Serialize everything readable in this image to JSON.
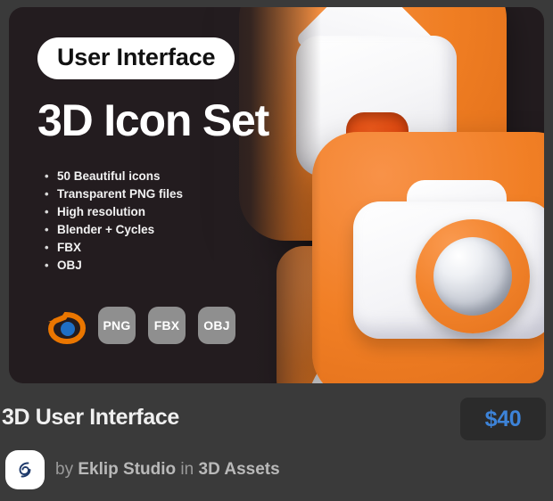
{
  "colors": {
    "page_background": "#3a3a3a",
    "card_background": "#231c1f",
    "accent_orange": "#f07e23",
    "price_blue": "#3d83d8",
    "badge_gray": "#8f8f8f",
    "blender_blue": "#1f6fc4",
    "blender_orange": "#ea7600",
    "avatar_logo": "#1f3a6b"
  },
  "preview": {
    "pill_label": "User Interface",
    "headline": "3D Icon Set",
    "features": [
      "50 Beautiful icons",
      "Transparent PNG files",
      "High resolution",
      "Blender + Cycles",
      "FBX",
      "OBJ"
    ],
    "formats": [
      {
        "icon": "blender-logo",
        "label": ""
      },
      {
        "icon": "file-format-badge",
        "label": "PNG"
      },
      {
        "icon": "file-format-badge",
        "label": "FBX"
      },
      {
        "icon": "file-format-badge",
        "label": "OBJ"
      }
    ],
    "artwork": {
      "icons": [
        {
          "name": "home-icon",
          "tile_color": "#f07e23"
        },
        {
          "name": "camera-icon",
          "tile_color": "#f17f25"
        },
        {
          "name": "person-icon",
          "tile_color": "#ef7d23"
        }
      ]
    }
  },
  "footer": {
    "product_title": "3D User Interface",
    "price": "$40",
    "byline": {
      "by_label": "by",
      "author": "Eklip Studio",
      "in_label": "in",
      "category": "3D Assets"
    }
  }
}
